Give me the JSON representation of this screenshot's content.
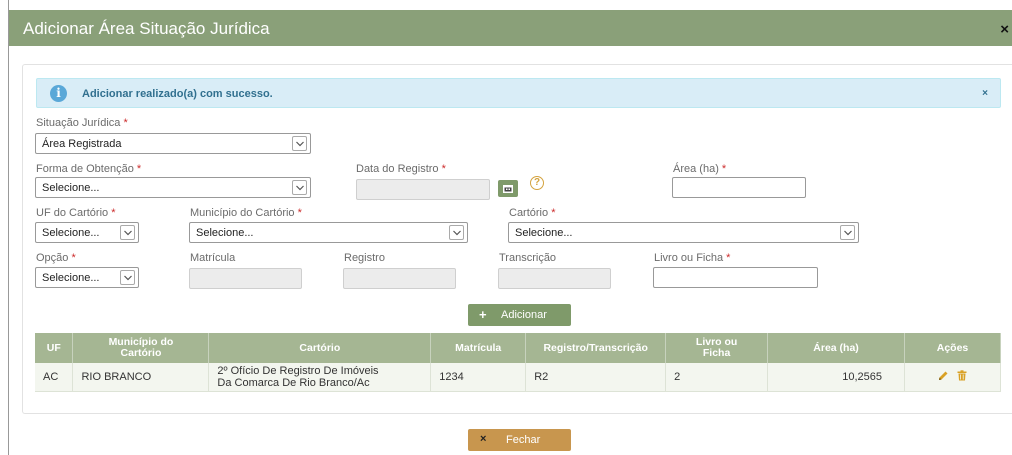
{
  "modal": {
    "title": "Adicionar Área Situação Jurídica",
    "close_label": "×"
  },
  "alert": {
    "text": "Adicionar realizado(a) com sucesso.",
    "close_label": "×",
    "info_glyph": "i"
  },
  "form": {
    "situacao": {
      "label": "Situação Jurídica",
      "required": "*",
      "value": "Área Registrada"
    },
    "forma": {
      "label": "Forma de Obtenção",
      "required": "*",
      "value": "Selecione..."
    },
    "data_registro": {
      "label": "Data do Registro",
      "required": "*",
      "value": ""
    },
    "area": {
      "label": "Área (ha)",
      "required": "*",
      "value": ""
    },
    "uf": {
      "label": "UF do Cartório",
      "required": "*",
      "value": "Selecione..."
    },
    "municipio": {
      "label": "Município do Cartório",
      "required": "*",
      "value": "Selecione..."
    },
    "cartorio": {
      "label": "Cartório",
      "required": "*",
      "value": "Selecione..."
    },
    "opcao": {
      "label": "Opção",
      "required": "*",
      "value": "Selecione..."
    },
    "matricula": {
      "label": "Matrícula",
      "value": ""
    },
    "registro": {
      "label": "Registro",
      "value": ""
    },
    "transcricao": {
      "label": "Transcrição",
      "value": ""
    },
    "livro": {
      "label": "Livro ou Ficha",
      "required": "*",
      "value": ""
    }
  },
  "help_glyph": "?",
  "add_button": {
    "icon": "+",
    "label": "Adicionar"
  },
  "table": {
    "headers": {
      "uf": "UF",
      "municipio_1": "Município do",
      "municipio_2": "Cartório",
      "cartorio": "Cartório",
      "matricula": "Matrícula",
      "registro": "Registro/Transcrição",
      "livro_1": "Livro ou",
      "livro_2": "Ficha",
      "area": "Área (ha)",
      "acoes": "Ações"
    },
    "rows": [
      {
        "uf": "AC",
        "municipio": "RIO BRANCO",
        "cartorio_1": "2º Ofício De Registro De Imóveis",
        "cartorio_2": "Da Comarca De Rio Branco/Ac",
        "matricula": "1234",
        "registro": "R2",
        "livro": "2",
        "area": "10,2565"
      }
    ]
  },
  "close_button": {
    "icon": "×",
    "label": "Fechar"
  },
  "icons": {
    "info": "info-icon",
    "close": "close-icon",
    "chevron": "chevron-down-icon",
    "calendar": "calendar-icon",
    "help": "help-icon",
    "add": "plus-icon",
    "edit": "pencil-icon",
    "delete": "trash-icon"
  },
  "colors": {
    "header": "#8aa079",
    "primary_button": "#7f9a6a",
    "table_header": "#a5b693",
    "close_button": "#c8964e",
    "alert_bg": "#d9edf7",
    "alert_text": "#31708f",
    "required": "#cc2b2b"
  }
}
